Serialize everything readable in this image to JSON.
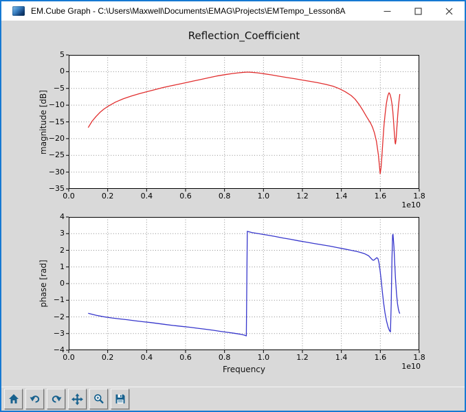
{
  "window": {
    "title": "EM.Cube Graph - C:\\Users\\Maxwell\\Documents\\EMAG\\Projects\\EMTempo_Lesson8A",
    "controls": [
      "minimize-icon",
      "maximize-icon",
      "close-icon"
    ],
    "border_color": "#1679d2"
  },
  "figure": {
    "title": "Reflection_Coefficient",
    "background": "#d9d9d9"
  },
  "toolbar": {
    "buttons": [
      {
        "name": "home",
        "icon": "home-icon"
      },
      {
        "name": "back",
        "icon": "back-arrow-icon"
      },
      {
        "name": "forward",
        "icon": "forward-arrow-icon"
      },
      {
        "name": "pan",
        "icon": "pan-arrows-icon"
      },
      {
        "name": "zoom",
        "icon": "zoom-magnifier-icon"
      },
      {
        "name": "save",
        "icon": "save-floppy-icon"
      }
    ],
    "icon_color": "#17618e"
  },
  "chart_data": [
    {
      "type": "line",
      "title": "Reflection_Coefficient",
      "xlabel": "",
      "ylabel": "magnitude [dB]",
      "x_offset_text": "1e10",
      "xlim": [
        0,
        1.8
      ],
      "ylim": [
        -35,
        5
      ],
      "xticks": [
        0,
        0.2,
        0.4,
        0.6,
        0.8,
        1.0,
        1.2,
        1.4,
        1.6,
        1.8
      ],
      "xtick_labels": [
        "0.0",
        "0.2",
        "0.4",
        "0.6",
        "0.8",
        "1.0",
        "1.2",
        "1.4",
        "1.6",
        "1.8"
      ],
      "yticks": [
        5,
        0,
        -5,
        -10,
        -15,
        -20,
        -25,
        -30,
        -35
      ],
      "ytick_labels": [
        "5",
        "0",
        "−5",
        "−10",
        "−15",
        "−20",
        "−25",
        "−30",
        "−35"
      ],
      "grid": true,
      "legend": null,
      "series": [
        {
          "name": "magnitude",
          "color": "#e12e2e",
          "points": [
            [
              0.1,
              -16.7
            ],
            [
              0.12,
              -14.8
            ],
            [
              0.14,
              -13.4
            ],
            [
              0.16,
              -12.2
            ],
            [
              0.18,
              -11.2
            ],
            [
              0.2,
              -10.4
            ],
            [
              0.24,
              -9.1
            ],
            [
              0.28,
              -8.1
            ],
            [
              0.32,
              -7.3
            ],
            [
              0.36,
              -6.6
            ],
            [
              0.4,
              -6.0
            ],
            [
              0.44,
              -5.4
            ],
            [
              0.48,
              -4.8
            ],
            [
              0.52,
              -4.3
            ],
            [
              0.56,
              -3.8
            ],
            [
              0.6,
              -3.3
            ],
            [
              0.64,
              -2.8
            ],
            [
              0.68,
              -2.3
            ],
            [
              0.72,
              -1.8
            ],
            [
              0.76,
              -1.3
            ],
            [
              0.8,
              -0.9
            ],
            [
              0.84,
              -0.55
            ],
            [
              0.87,
              -0.35
            ],
            [
              0.9,
              -0.18
            ],
            [
              0.92,
              -0.12
            ],
            [
              0.94,
              -0.18
            ],
            [
              0.97,
              -0.35
            ],
            [
              1.0,
              -0.6
            ],
            [
              1.04,
              -0.95
            ],
            [
              1.08,
              -1.35
            ],
            [
              1.12,
              -1.75
            ],
            [
              1.16,
              -2.1
            ],
            [
              1.2,
              -2.5
            ],
            [
              1.24,
              -2.9
            ],
            [
              1.28,
              -3.3
            ],
            [
              1.32,
              -3.8
            ],
            [
              1.36,
              -4.4
            ],
            [
              1.39,
              -5.1
            ],
            [
              1.42,
              -6.0
            ],
            [
              1.45,
              -7.1
            ],
            [
              1.47,
              -8.2
            ],
            [
              1.49,
              -9.7
            ],
            [
              1.51,
              -11.5
            ],
            [
              1.53,
              -13.5
            ],
            [
              1.55,
              -15.4
            ],
            [
              1.56,
              -16.6
            ],
            [
              1.57,
              -18.3
            ],
            [
              1.58,
              -20.8
            ],
            [
              1.59,
              -24.8
            ],
            [
              1.595,
              -27.8
            ],
            [
              1.599,
              -30.5
            ],
            [
              1.604,
              -28.5
            ],
            [
              1.609,
              -24.5
            ],
            [
              1.614,
              -20.0
            ],
            [
              1.619,
              -16.0
            ],
            [
              1.625,
              -12.5
            ],
            [
              1.631,
              -9.6
            ],
            [
              1.637,
              -7.6
            ],
            [
              1.641,
              -6.8
            ],
            [
              1.645,
              -6.3
            ],
            [
              1.65,
              -6.8
            ],
            [
              1.655,
              -7.9
            ],
            [
              1.66,
              -9.6
            ],
            [
              1.664,
              -11.8
            ],
            [
              1.668,
              -14.8
            ],
            [
              1.672,
              -18.2
            ],
            [
              1.676,
              -21.3
            ],
            [
              1.678,
              -21.6
            ],
            [
              1.681,
              -20.3
            ],
            [
              1.685,
              -16.8
            ],
            [
              1.689,
              -13.2
            ],
            [
              1.693,
              -10.4
            ],
            [
              1.697,
              -8.2
            ],
            [
              1.7,
              -6.7
            ]
          ]
        }
      ]
    },
    {
      "type": "line",
      "title": "",
      "xlabel": "Frequency",
      "ylabel": "phase [rad]",
      "x_offset_text": "1e10",
      "xlim": [
        0,
        1.8
      ],
      "ylim": [
        -4,
        4
      ],
      "xticks": [
        0,
        0.2,
        0.4,
        0.6,
        0.8,
        1.0,
        1.2,
        1.4,
        1.6,
        1.8
      ],
      "xtick_labels": [
        "0.0",
        "0.2",
        "0.4",
        "0.6",
        "0.8",
        "1.0",
        "1.2",
        "1.4",
        "1.6",
        "1.8"
      ],
      "yticks": [
        4,
        3,
        2,
        1,
        0,
        -1,
        -2,
        -3,
        -4
      ],
      "ytick_labels": [
        "4",
        "3",
        "2",
        "1",
        "0",
        "−1",
        "−2",
        "−3",
        "−4"
      ],
      "grid": true,
      "legend": null,
      "series": [
        {
          "name": "phase",
          "color": "#3636cc",
          "points": [
            [
              0.1,
              -1.78
            ],
            [
              0.14,
              -1.9
            ],
            [
              0.18,
              -1.99
            ],
            [
              0.22,
              -2.06
            ],
            [
              0.26,
              -2.12
            ],
            [
              0.3,
              -2.17
            ],
            [
              0.34,
              -2.23
            ],
            [
              0.38,
              -2.29
            ],
            [
              0.42,
              -2.34
            ],
            [
              0.46,
              -2.4
            ],
            [
              0.5,
              -2.46
            ],
            [
              0.54,
              -2.52
            ],
            [
              0.58,
              -2.57
            ],
            [
              0.62,
              -2.62
            ],
            [
              0.66,
              -2.68
            ],
            [
              0.7,
              -2.74
            ],
            [
              0.74,
              -2.8
            ],
            [
              0.78,
              -2.87
            ],
            [
              0.82,
              -2.93
            ],
            [
              0.85,
              -2.98
            ],
            [
              0.88,
              -3.04
            ],
            [
              0.9,
              -3.09
            ],
            [
              0.912,
              -3.14
            ],
            [
              0.917,
              3.14
            ],
            [
              0.94,
              3.07
            ],
            [
              0.98,
              2.99
            ],
            [
              1.02,
              2.91
            ],
            [
              1.06,
              2.83
            ],
            [
              1.1,
              2.74
            ],
            [
              1.14,
              2.66
            ],
            [
              1.18,
              2.57
            ],
            [
              1.22,
              2.49
            ],
            [
              1.26,
              2.41
            ],
            [
              1.3,
              2.33
            ],
            [
              1.34,
              2.25
            ],
            [
              1.38,
              2.16
            ],
            [
              1.42,
              2.07
            ],
            [
              1.45,
              2.0
            ],
            [
              1.48,
              1.93
            ],
            [
              1.5,
              1.87
            ],
            [
              1.52,
              1.79
            ],
            [
              1.54,
              1.67
            ],
            [
              1.552,
              1.52
            ],
            [
              1.56,
              1.42
            ],
            [
              1.566,
              1.4
            ],
            [
              1.574,
              1.48
            ],
            [
              1.582,
              1.56
            ],
            [
              1.588,
              1.5
            ],
            [
              1.593,
              1.25
            ],
            [
              1.598,
              0.85
            ],
            [
              1.604,
              0.25
            ],
            [
              1.61,
              -0.45
            ],
            [
              1.617,
              -1.15
            ],
            [
              1.624,
              -1.75
            ],
            [
              1.632,
              -2.25
            ],
            [
              1.64,
              -2.62
            ],
            [
              1.647,
              -2.83
            ],
            [
              1.652,
              -2.9
            ],
            [
              1.656,
              -1.2
            ],
            [
              1.66,
              1.5
            ],
            [
              1.663,
              2.9
            ],
            [
              1.665,
              2.96
            ],
            [
              1.67,
              2.2
            ],
            [
              1.674,
              1.2
            ],
            [
              1.678,
              0.3
            ],
            [
              1.683,
              -0.6
            ],
            [
              1.688,
              -1.2
            ],
            [
              1.693,
              -1.55
            ],
            [
              1.697,
              -1.72
            ],
            [
              1.7,
              -1.8
            ]
          ]
        }
      ]
    }
  ]
}
